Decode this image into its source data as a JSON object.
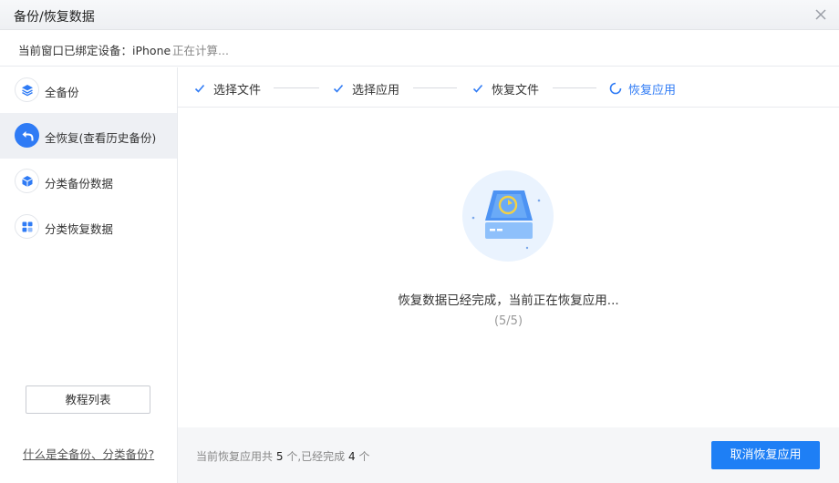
{
  "window": {
    "title": "备份/恢复数据"
  },
  "device": {
    "label": "当前窗口已绑定设备：iPhone",
    "status": "正在计算..."
  },
  "sidebar": {
    "items": [
      {
        "label": "全备份",
        "icon": "layers-icon"
      },
      {
        "label": "全恢复(查看历史备份)",
        "icon": "restore-arrow-icon",
        "active": true
      },
      {
        "label": "分类备份数据",
        "icon": "cube-icon"
      },
      {
        "label": "分类恢复数据",
        "icon": "grid-icon"
      }
    ],
    "tutorial_button": "教程列表",
    "help_link": "什么是全备份、分类备份?"
  },
  "steps": [
    {
      "label": "选择文件",
      "state": "done"
    },
    {
      "label": "选择应用",
      "state": "done"
    },
    {
      "label": "恢复文件",
      "state": "done"
    },
    {
      "label": "恢复应用",
      "state": "in-progress"
    }
  ],
  "main": {
    "message": "恢复数据已经完成，当前正在恢复应用...",
    "progress": "(5/5)"
  },
  "footer": {
    "summary_prefix": "当前恢复应用共",
    "total": "5",
    "summary_mid": "个,已经完成",
    "done": "4",
    "summary_suffix": "个",
    "cancel_button": "取消恢复应用"
  },
  "colors": {
    "accent": "#2f7bf5",
    "button": "#1e7ff5"
  }
}
